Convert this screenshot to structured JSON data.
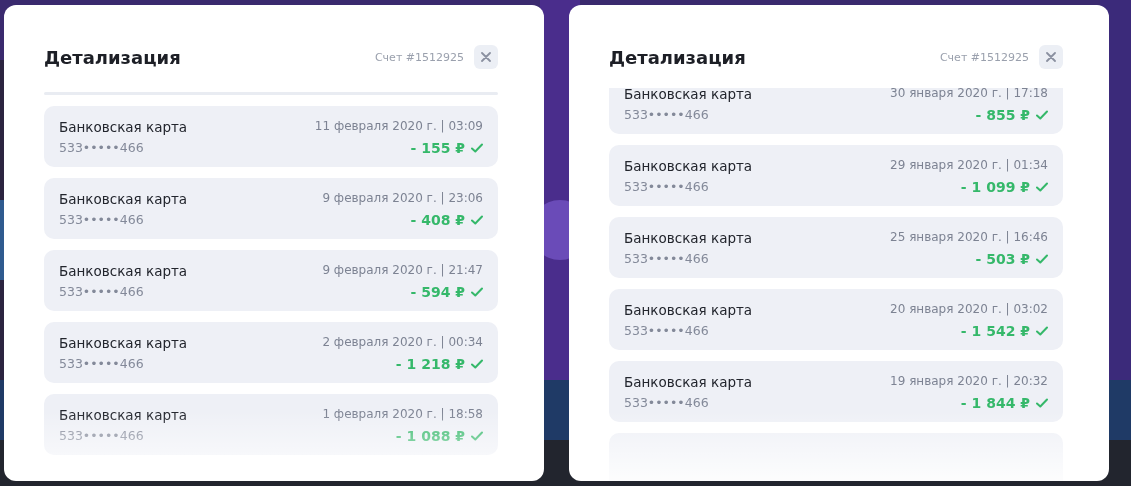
{
  "panels": [
    {
      "title": "Детализация",
      "account": "Счет #1512925",
      "transactions": [
        {
          "method": "Банковская карта",
          "card": "533•••••466",
          "date": "11 февраля 2020 г. | 03:09",
          "amount": "- 155 ₽",
          "completed": true
        },
        {
          "method": "Банковская карта",
          "card": "533•••••466",
          "date": "9 февраля 2020 г. | 23:06",
          "amount": "- 408 ₽",
          "completed": true
        },
        {
          "method": "Банковская карта",
          "card": "533•••••466",
          "date": "9 февраля 2020 г. | 21:47",
          "amount": "- 594 ₽",
          "completed": true
        },
        {
          "method": "Банковская карта",
          "card": "533•••••466",
          "date": "2 февраля 2020 г. | 00:34",
          "amount": "- 1 218 ₽",
          "completed": true
        },
        {
          "method": "Банковская карта",
          "card": "533•••••466",
          "date": "1 февраля 2020 г. | 18:58",
          "amount": "- 1 088 ₽",
          "completed": true
        }
      ]
    },
    {
      "title": "Детализация",
      "account": "Счет #1512925",
      "transactions": [
        {
          "method": "Банковская карта",
          "card": "533•••••466",
          "date": "30 января 2020 г. | 17:18",
          "amount": "- 855 ₽",
          "completed": true
        },
        {
          "method": "Банковская карта",
          "card": "533•••••466",
          "date": "29 января 2020 г. | 01:34",
          "amount": "- 1 099 ₽",
          "completed": true
        },
        {
          "method": "Банковская карта",
          "card": "533•••••466",
          "date": "25 января 2020 г. | 16:46",
          "amount": "- 503 ₽",
          "completed": true
        },
        {
          "method": "Банковская карта",
          "card": "533•••••466",
          "date": "20 января 2020 г. | 03:02",
          "amount": "- 1 542 ₽",
          "completed": true
        },
        {
          "method": "Банковская карта",
          "card": "533•••••466",
          "date": "19 января 2020 г. | 20:32",
          "amount": "- 1 844 ₽",
          "completed": true
        }
      ]
    }
  ]
}
